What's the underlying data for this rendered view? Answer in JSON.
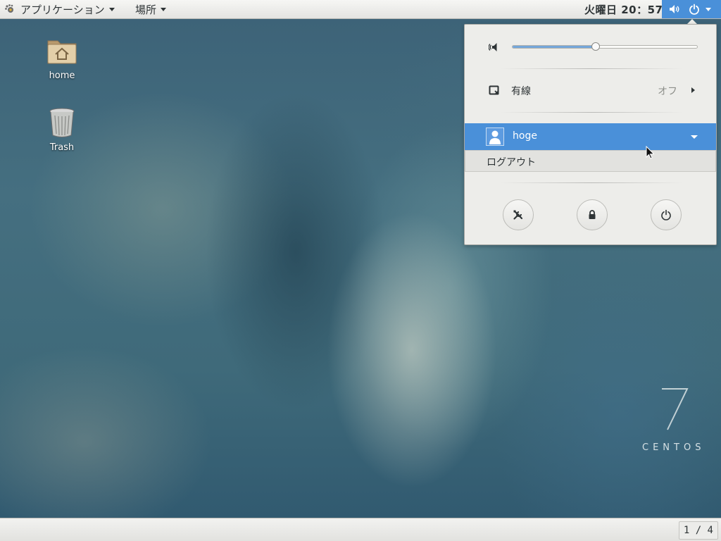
{
  "topbar": {
    "applications_label": "アプリケーション",
    "places_label": "場所",
    "clock": "火曜日 20：57"
  },
  "desktop": {
    "icons": [
      {
        "label": "home",
        "icon": "home-folder-icon"
      },
      {
        "label": "Trash",
        "icon": "trash-icon"
      }
    ],
    "logo": {
      "number": "7",
      "word": "CENTOS"
    }
  },
  "system_menu": {
    "volume": {
      "level": 0.45,
      "icon": "speaker-icon"
    },
    "network": {
      "label": "有線",
      "status": "オフ",
      "icon": "wired-network-icon"
    },
    "user": {
      "name": "hoge",
      "icon": "avatar-icon",
      "submenu": {
        "logout_label": "ログアウト"
      }
    },
    "buttons": [
      {
        "name": "settings",
        "icon": "settings-icon"
      },
      {
        "name": "lock",
        "icon": "lock-icon"
      },
      {
        "name": "power-off",
        "icon": "power-icon"
      }
    ]
  },
  "bottombar": {
    "workspace_indicator": "1 / 4"
  },
  "colors": {
    "accent": "#4a90d9",
    "menu_bg": "#ededea",
    "topbar_bg": "#e9e9e6"
  }
}
